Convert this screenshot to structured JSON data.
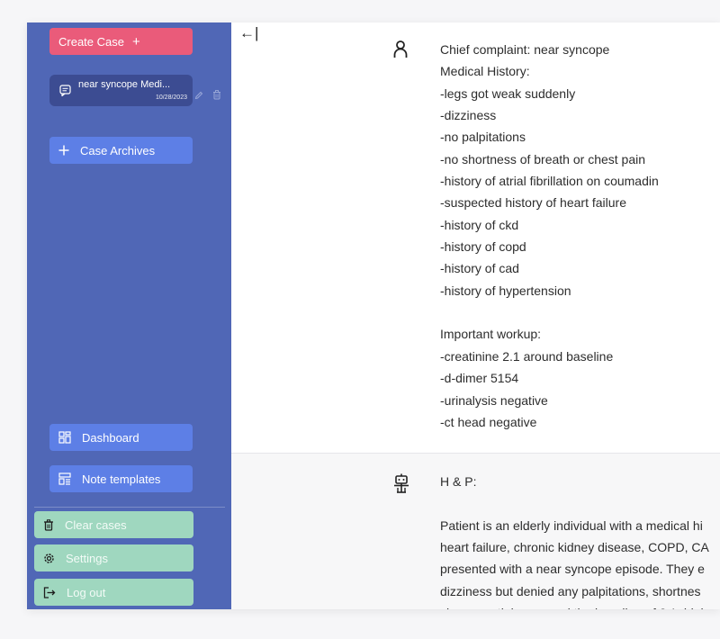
{
  "sidebar": {
    "create_case_label": "Create Case",
    "create_case_plus": "+",
    "case_item": {
      "title": "near syncope Medi...",
      "date": "10/28/2023"
    },
    "case_archives_label": "Case Archives",
    "dashboard_label": "Dashboard",
    "note_templates_label": "Note templates",
    "clear_cases_label": "Clear cases",
    "settings_label": "Settings",
    "logout_label": "Log out"
  },
  "main": {
    "collapse_arrow": "←|",
    "user_message": "Chief complaint: near syncope\nMedical History:\n-legs got weak suddenly\n-dizziness\n-no palpitations\n-no shortness of breath or chest pain\n-history of atrial fibrillation on coumadin\n-suspected history of heart failure\n-history of ckd\n-history of copd\n-history of cad\n-history of hypertension\n\nImportant workup:\n-creatinine 2.1 around baseline\n-d-dimer 5154\n-urinalysis negative\n-ct head negative",
    "ai_message": "H & P:\n\nPatient is an elderly individual with a medical hi\nheart failure, chronic kidney disease, COPD, CA\npresented with a near syncope episode. They e\ndizziness but denied any palpitations, shortnes\nshow creatinine around the baseline of 2.1, high"
  },
  "colors": {
    "sidebar_bg": "#5067b6",
    "create_case": "#ea5b7a",
    "nav_button": "#5d7fe6",
    "case_item": "#3c4c92",
    "green_button": "#9fd7bf"
  },
  "icons": [
    "plus-icon",
    "chat-icon",
    "pencil-icon",
    "trash-icon",
    "dashboard-icon",
    "template-icon",
    "settings-icon",
    "logout-icon",
    "user-icon",
    "bot-icon"
  ]
}
